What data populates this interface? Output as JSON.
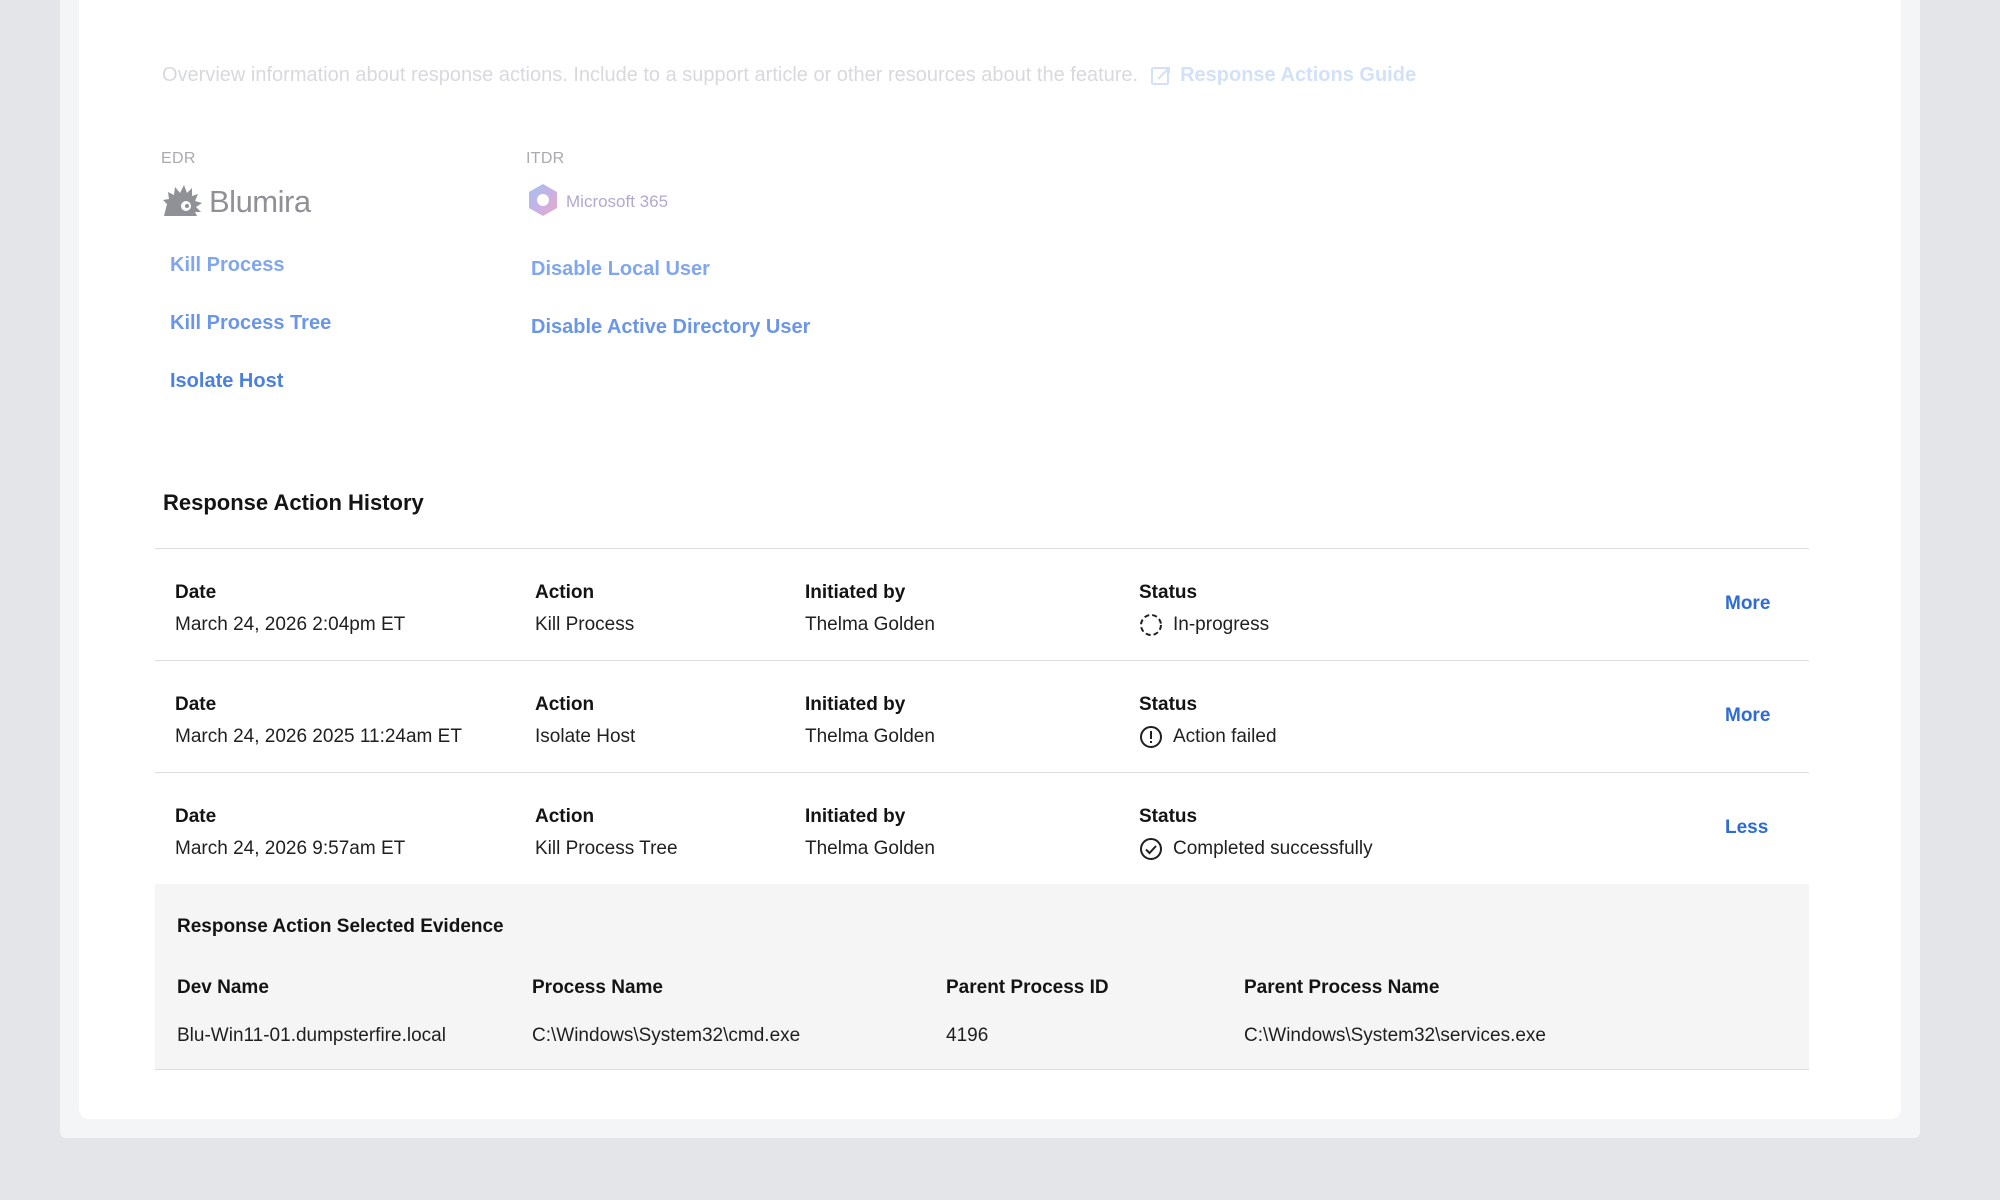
{
  "intro": {
    "faded_title": "",
    "text": "Overview information about response actions. Include to a support article or other resources about the feature.",
    "guide_link": "Response Actions Guide"
  },
  "edr": {
    "label": "EDR",
    "vendor": "Blumira",
    "actions": [
      {
        "label": "Kill Process",
        "color": "#7fa6ee"
      },
      {
        "label": "Kill Process Tree",
        "color": "#6b96e8"
      },
      {
        "label": "Isolate Host",
        "color": "#4c80e0"
      }
    ]
  },
  "itdr": {
    "label": "ITDR",
    "vendor": "Microsoft 365",
    "actions": [
      {
        "label": "Disable Local User",
        "color": "#7fa6ee"
      },
      {
        "label": "Disable Active Directory User",
        "color": "#6b96e8"
      }
    ]
  },
  "history": {
    "title": "Response Action History",
    "column_labels": {
      "date": "Date",
      "action": "Action",
      "initiated_by": "Initiated by",
      "status": "Status"
    },
    "rows": [
      {
        "date": "March 24, 2026 2:04pm ET",
        "action": "Kill Process",
        "initiated_by": "Thelma Golden",
        "status": "In-progress",
        "status_icon": "in-progress-icon",
        "toggle": "More"
      },
      {
        "date": "March 24, 2026 2025 11:24am ET",
        "action": "Isolate Host",
        "initiated_by": "Thelma Golden",
        "status": "Action failed",
        "status_icon": "alert-circle-icon",
        "toggle": "More"
      },
      {
        "date": "March 24, 2026 9:57am ET",
        "action": "Kill Process Tree",
        "initiated_by": "Thelma Golden",
        "status": "Completed successfully",
        "status_icon": "check-circle-icon",
        "toggle": "Less"
      }
    ],
    "evidence": {
      "title": "Response Action Selected Evidence",
      "columns": [
        {
          "label": "Dev Name",
          "value": "Blu-Win11-01.dumpsterfire.local"
        },
        {
          "label": "Process Name",
          "value": "C:\\Windows\\System32\\cmd.exe"
        },
        {
          "label": "Parent Process ID",
          "value": "4196"
        },
        {
          "label": "Parent Process Name",
          "value": "C:\\Windows\\System32\\services.exe"
        }
      ]
    }
  },
  "colors": {
    "link": "#2f6bd8",
    "background": "#e3e5e9",
    "card": "#ffffff",
    "evidence_bg": "#f5f5f6"
  }
}
